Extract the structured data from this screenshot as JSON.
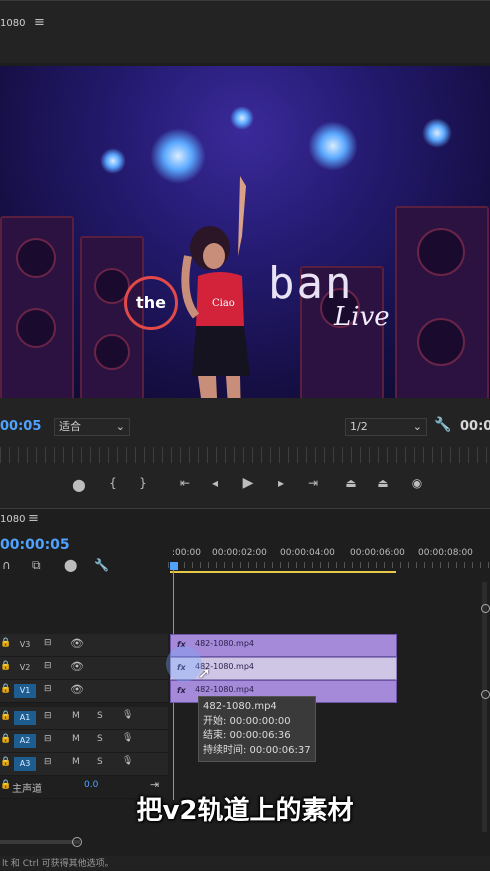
{
  "monitor": {
    "sequence_title": "1080",
    "menu_icon": "hamburger-menu-icon",
    "timecode_in": "00:05",
    "fit_label": "适合",
    "resolution": "1/2",
    "timecode_out": "00:0",
    "video_sign": {
      "the": "the",
      "ban": "ban",
      "live": "Live"
    }
  },
  "transport": {
    "buttons": [
      "marker-icon",
      "mark-in-icon",
      "mark-out-icon",
      "go-to-in-icon",
      "step-back-icon",
      "play-icon",
      "step-forward-icon",
      "go-to-out-icon",
      "lift-icon",
      "extract-icon",
      "export-frame-icon"
    ]
  },
  "timeline": {
    "sequence_title": "1080",
    "playhead_timecode": "00:00:05",
    "ruler_labels": [
      ":00:00",
      "00:00:02:00",
      "00:00:04:00",
      "00:00:06:00",
      "00:00:08:00"
    ],
    "video_tracks": [
      {
        "label": "V3",
        "on": false,
        "clip": "482-1080.mp4"
      },
      {
        "label": "V2",
        "on": false,
        "clip": "482-1080.mp4"
      },
      {
        "label": "V1",
        "on": true,
        "clip": "482-1080.mp4"
      }
    ],
    "audio_tracks": [
      {
        "label": "A1",
        "m": "M",
        "s": "S"
      },
      {
        "label": "A2",
        "m": "M",
        "s": "S"
      },
      {
        "label": "A3",
        "m": "M",
        "s": "S"
      }
    ],
    "master": {
      "label": "主声道",
      "value": "0.0"
    },
    "tooltip": {
      "name": "482-1080.mp4",
      "start": "开始: 00:00:00:00",
      "end": "结束: 00:00:06:36",
      "duration": "持续时间: 00:00:06:37"
    },
    "footer_hint": "lt 和 Ctrl 可获得其他选项。"
  },
  "caption": "把v2轨道上的素材",
  "colors": {
    "accent": "#4fa3ff",
    "clip": "#a58ad9",
    "selected_clip": "#cfc6e6"
  }
}
